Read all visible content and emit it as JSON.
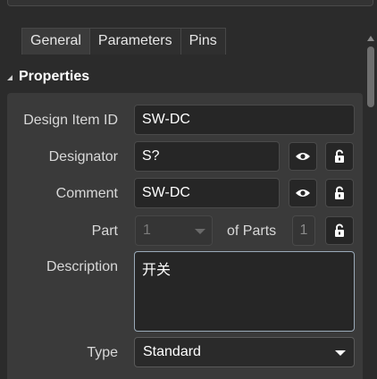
{
  "tabs": [
    {
      "label": "General",
      "active": true
    },
    {
      "label": "Parameters",
      "active": false
    },
    {
      "label": "Pins",
      "active": false
    }
  ],
  "section": {
    "title": "Properties"
  },
  "fields": {
    "design_item_id": {
      "label": "Design Item ID",
      "value": "SW-DC"
    },
    "designator": {
      "label": "Designator",
      "value": "S?"
    },
    "comment": {
      "label": "Comment",
      "value": "SW-DC"
    },
    "part": {
      "label": "Part",
      "value": "1",
      "of_parts_label": "of Parts",
      "count": "1"
    },
    "description": {
      "label": "Description",
      "value": "开关"
    },
    "type": {
      "label": "Type",
      "value": "Standard"
    }
  },
  "icons": {
    "visibility": "eye-icon",
    "lock": "unlock-icon",
    "dropdown": "chevron-down-icon"
  },
  "colors": {
    "background": "#2b2b2b",
    "panel": "#3a3a3a",
    "field": "#262626",
    "focus_border": "#9aaab8"
  }
}
